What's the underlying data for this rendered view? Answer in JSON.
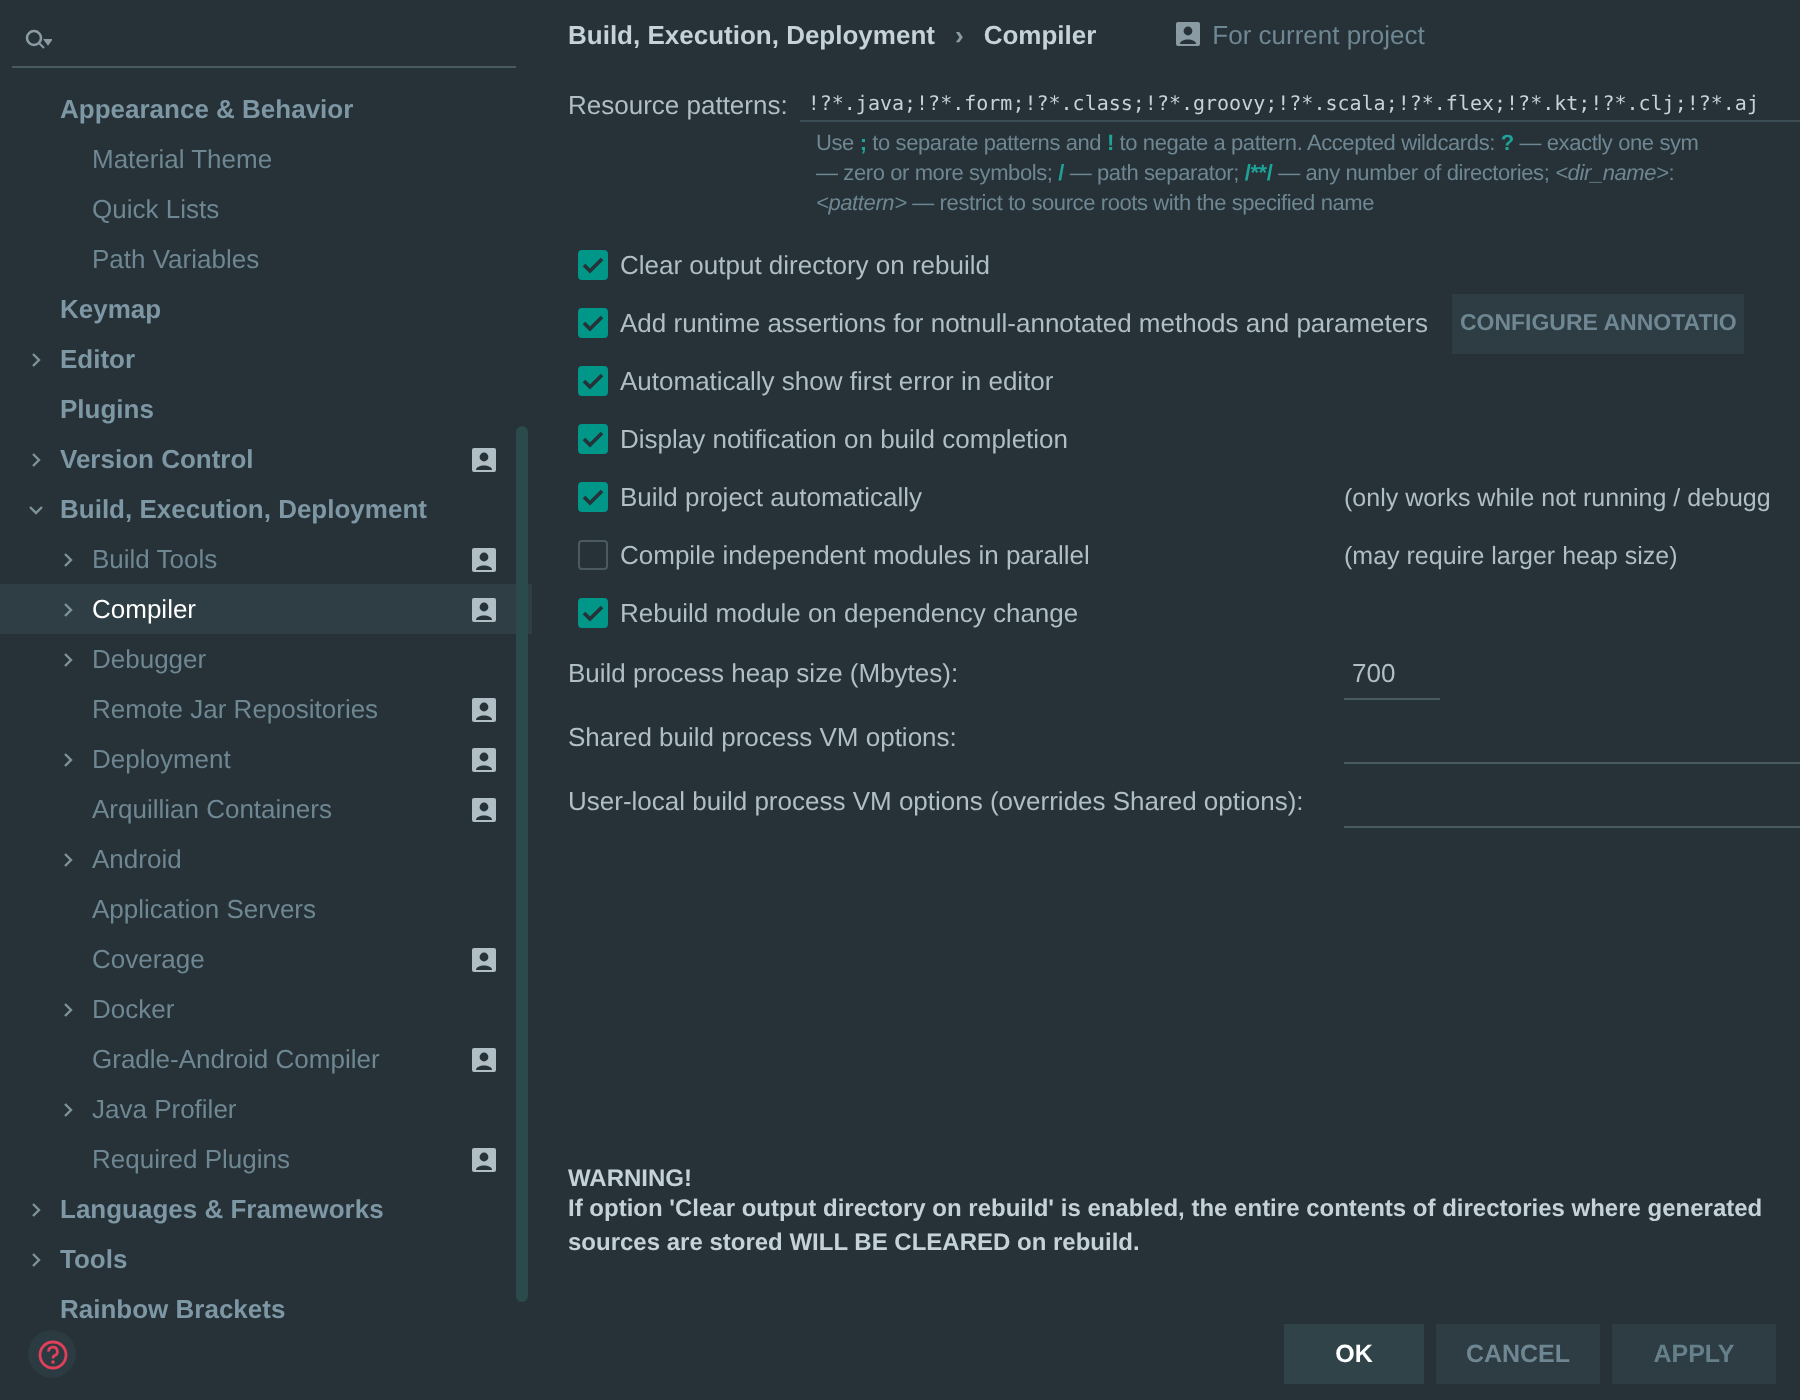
{
  "sidebar": {
    "items": [
      {
        "label": "Appearance & Behavior",
        "top": true,
        "expandable": false,
        "expanded": true,
        "shared": false,
        "selected": false,
        "children": [
          {
            "label": "Material Theme",
            "top": false,
            "expandable": false,
            "shared": false,
            "selected": false
          },
          {
            "label": "Quick Lists",
            "top": false,
            "expandable": false,
            "shared": false,
            "selected": false
          },
          {
            "label": "Path Variables",
            "top": false,
            "expandable": false,
            "shared": false,
            "selected": false
          }
        ]
      },
      {
        "label": "Keymap",
        "top": true,
        "expandable": false,
        "shared": false,
        "selected": false
      },
      {
        "label": "Editor",
        "top": true,
        "expandable": true,
        "expanded": false,
        "shared": false,
        "selected": false
      },
      {
        "label": "Plugins",
        "top": true,
        "expandable": false,
        "shared": false,
        "selected": false
      },
      {
        "label": "Version Control",
        "top": true,
        "expandable": true,
        "expanded": false,
        "shared": true,
        "selected": false
      },
      {
        "label": "Build, Execution, Deployment",
        "top": true,
        "expandable": true,
        "expanded": true,
        "shared": false,
        "selected": false,
        "children": [
          {
            "label": "Build Tools",
            "top": false,
            "expandable": true,
            "expanded": false,
            "shared": true,
            "selected": false
          },
          {
            "label": "Compiler",
            "top": false,
            "expandable": true,
            "expanded": false,
            "shared": true,
            "selected": true
          },
          {
            "label": "Debugger",
            "top": false,
            "expandable": true,
            "expanded": false,
            "shared": false,
            "selected": false
          },
          {
            "label": "Remote Jar Repositories",
            "top": false,
            "expandable": false,
            "shared": true,
            "selected": false
          },
          {
            "label": "Deployment",
            "top": false,
            "expandable": true,
            "expanded": false,
            "shared": true,
            "selected": false
          },
          {
            "label": "Arquillian Containers",
            "top": false,
            "expandable": false,
            "shared": true,
            "selected": false
          },
          {
            "label": "Android",
            "top": false,
            "expandable": true,
            "expanded": false,
            "shared": false,
            "selected": false
          },
          {
            "label": "Application Servers",
            "top": false,
            "expandable": false,
            "shared": false,
            "selected": false
          },
          {
            "label": "Coverage",
            "top": false,
            "expandable": false,
            "shared": true,
            "selected": false
          },
          {
            "label": "Docker",
            "top": false,
            "expandable": true,
            "expanded": false,
            "shared": false,
            "selected": false
          },
          {
            "label": "Gradle-Android Compiler",
            "top": false,
            "expandable": false,
            "shared": true,
            "selected": false
          },
          {
            "label": "Java Profiler",
            "top": false,
            "expandable": true,
            "expanded": false,
            "shared": false,
            "selected": false
          },
          {
            "label": "Required Plugins",
            "top": false,
            "expandable": false,
            "shared": true,
            "selected": false
          }
        ]
      },
      {
        "label": "Languages & Frameworks",
        "top": true,
        "expandable": true,
        "expanded": false,
        "shared": false,
        "selected": false
      },
      {
        "label": "Tools",
        "top": true,
        "expandable": true,
        "expanded": false,
        "shared": false,
        "selected": false
      },
      {
        "label": "Rainbow Brackets",
        "top": true,
        "expandable": false,
        "shared": false,
        "selected": false
      }
    ]
  },
  "breadcrumb": [
    "Build, Execution, Deployment",
    "›",
    "Compiler"
  ],
  "scope": "For current project",
  "resource_patterns": {
    "label": "Resource patterns:",
    "value": "!?*.java;!?*.form;!?*.class;!?*.groovy;!?*.scala;!?*.flex;!?*.kt;!?*.clj;!?*.aj",
    "hint_lines": [
      [
        {
          "kind": "plain",
          "text": "Use "
        },
        {
          "kind": "key",
          "text": ";"
        },
        {
          "kind": "plain",
          "text": " to separate patterns and "
        },
        {
          "kind": "key",
          "text": "!"
        },
        {
          "kind": "plain",
          "text": " to negate a pattern. Accepted wildcards: "
        },
        {
          "kind": "key",
          "text": "?"
        },
        {
          "kind": "plain",
          "text": " — exactly one sym"
        }
      ],
      [
        {
          "kind": "plain",
          "text": "— zero or more symbols; "
        },
        {
          "kind": "key",
          "text": "/"
        },
        {
          "kind": "plain",
          "text": " — path separator; "
        },
        {
          "kind": "key",
          "text": "/**/"
        },
        {
          "kind": "plain",
          "text": " — any number of directories; "
        },
        {
          "kind": "var",
          "text": "<dir_name>"
        },
        {
          "kind": "plain",
          "text": ":"
        }
      ],
      [
        {
          "kind": "var",
          "text": "<pattern>"
        },
        {
          "kind": "plain",
          "text": " — restrict to source roots with the specified name"
        }
      ]
    ]
  },
  "options": [
    {
      "label": "Clear output directory on rebuild",
      "checked": true
    },
    {
      "label": "Add runtime assertions for notnull-annotated methods and parameters",
      "checked": true,
      "button": "CONFIGURE ANNOTATIO"
    },
    {
      "label": "Automatically show first error in editor",
      "checked": true
    },
    {
      "label": "Display notification on build completion",
      "checked": true
    },
    {
      "label": "Build project automatically",
      "checked": true,
      "note": "(only works while not running / debugg"
    },
    {
      "label": "Compile independent modules in parallel",
      "checked": false,
      "note": "(may require larger heap size)"
    },
    {
      "label": "Rebuild module on dependency change",
      "checked": true
    }
  ],
  "fields": [
    {
      "label": "Build process heap size (Mbytes):",
      "value": "700",
      "kind": "short"
    },
    {
      "label": "Shared build process VM options:",
      "kind": "wide"
    },
    {
      "label": "User-local build process VM options (overrides Shared options):",
      "kind": "wide"
    }
  ],
  "warning": {
    "title": "WARNING!",
    "text": "If option 'Clear output directory on rebuild' is enabled, the entire contents of directories where generated sources are stored WILL BE CLEARED on rebuild."
  },
  "buttons": [
    {
      "label": "OK",
      "kind": "primary"
    },
    {
      "label": "CANCEL",
      "kind": "normal"
    },
    {
      "label": "APPLY",
      "kind": "disabled"
    }
  ]
}
